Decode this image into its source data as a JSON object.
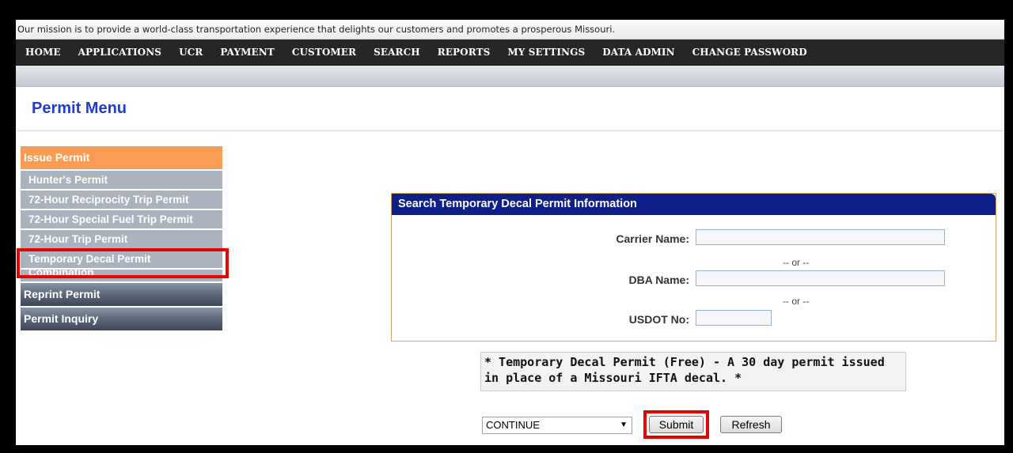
{
  "mission": "Our mission is to provide a world-class transportation experience that delights our customers and promotes a prosperous Missouri.",
  "nav": [
    "HOME",
    "APPLICATIONS",
    "UCR",
    "PAYMENT",
    "CUSTOMER",
    "SEARCH",
    "REPORTS",
    "MY SETTINGS",
    "DATA ADMIN",
    "CHANGE PASSWORD"
  ],
  "page_title": "Permit Menu",
  "sidebar": {
    "issue_permit": "Issue Permit",
    "items": [
      "Hunter's Permit",
      "72-Hour Reciprocity Trip Permit",
      "72-Hour Special Fuel Trip Permit",
      "72-Hour Trip Permit",
      "Temporary Decal Permit",
      "Combination"
    ],
    "reprint_permit": "Reprint Permit",
    "permit_inquiry": "Permit Inquiry"
  },
  "search": {
    "header": "Search Temporary Decal Permit Information",
    "carrier_label": "Carrier Name:",
    "or1": "-- or --",
    "dba_label": "DBA Name:",
    "or2": "-- or --",
    "usdot_label": "USDOT No:"
  },
  "info_text_line1": "* Temporary Decal Permit (Free) - A 30 day permit issued",
  "info_text_line2": "in place of a Missouri IFTA decal. *",
  "action": {
    "selected": "CONTINUE",
    "submit": "Submit",
    "refresh": "Refresh"
  },
  "colors": {
    "title_blue": "#1e3ccf",
    "panel_header": "#0f1f8a",
    "issue_orange": "#f99c55",
    "highlight_red": "#e60000"
  }
}
